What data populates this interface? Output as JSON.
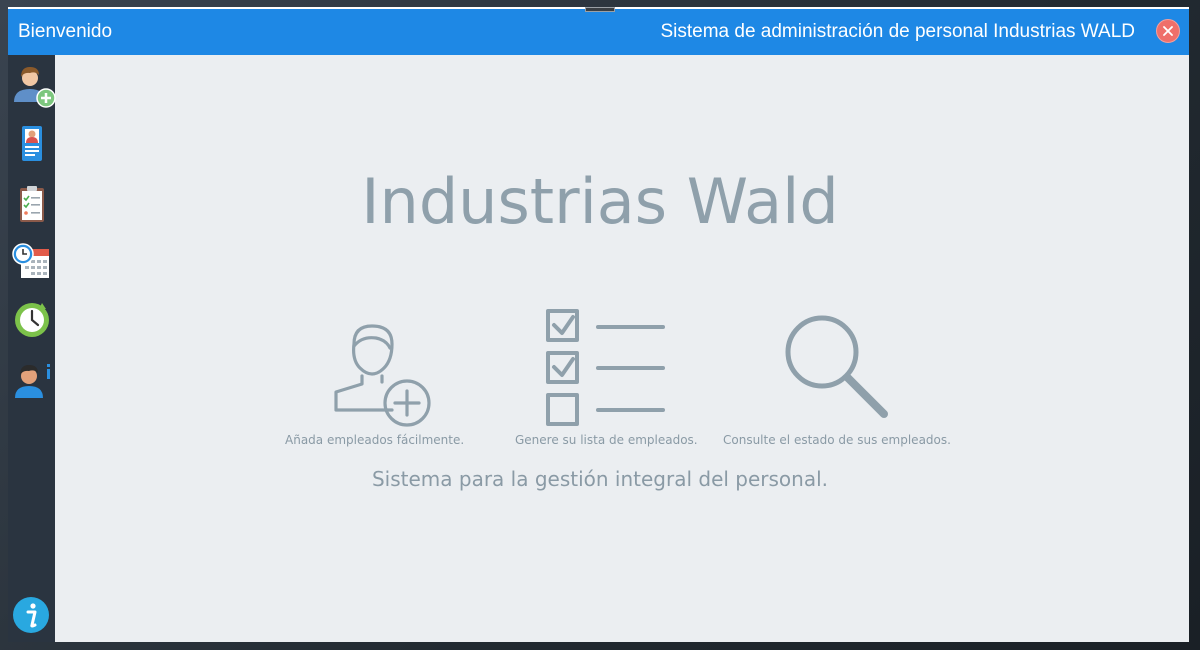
{
  "window": {
    "title_left": "Bienvenido",
    "title_right": "Sistema de administración de personal Industrias WALD"
  },
  "sidebar": {
    "items": [
      {
        "icon": "add-user-icon"
      },
      {
        "icon": "employee-id-card-icon"
      },
      {
        "icon": "checklist-clipboard-icon"
      },
      {
        "icon": "calendar-clock-icon"
      },
      {
        "icon": "clock-icon"
      },
      {
        "icon": "user-info-icon"
      }
    ],
    "bottom_icon": "info-icon"
  },
  "main": {
    "brand": "Industrias Wald",
    "features": [
      {
        "icon": "add-employee-icon",
        "caption": "Añada empleados fácilmente."
      },
      {
        "icon": "checklist-icon",
        "caption": "Genere su lista de empleados."
      },
      {
        "icon": "magnifier-icon",
        "caption": "Consulte el estado de sus empleados."
      }
    ],
    "tagline": "Sistema para la gestión integral del personal."
  },
  "colors": {
    "titlebar": "#1e88e5",
    "sidebar": "#2a3440",
    "content_bg": "#ebeef1",
    "muted_text": "#8fa0ab",
    "close": "#ef6f6a"
  }
}
